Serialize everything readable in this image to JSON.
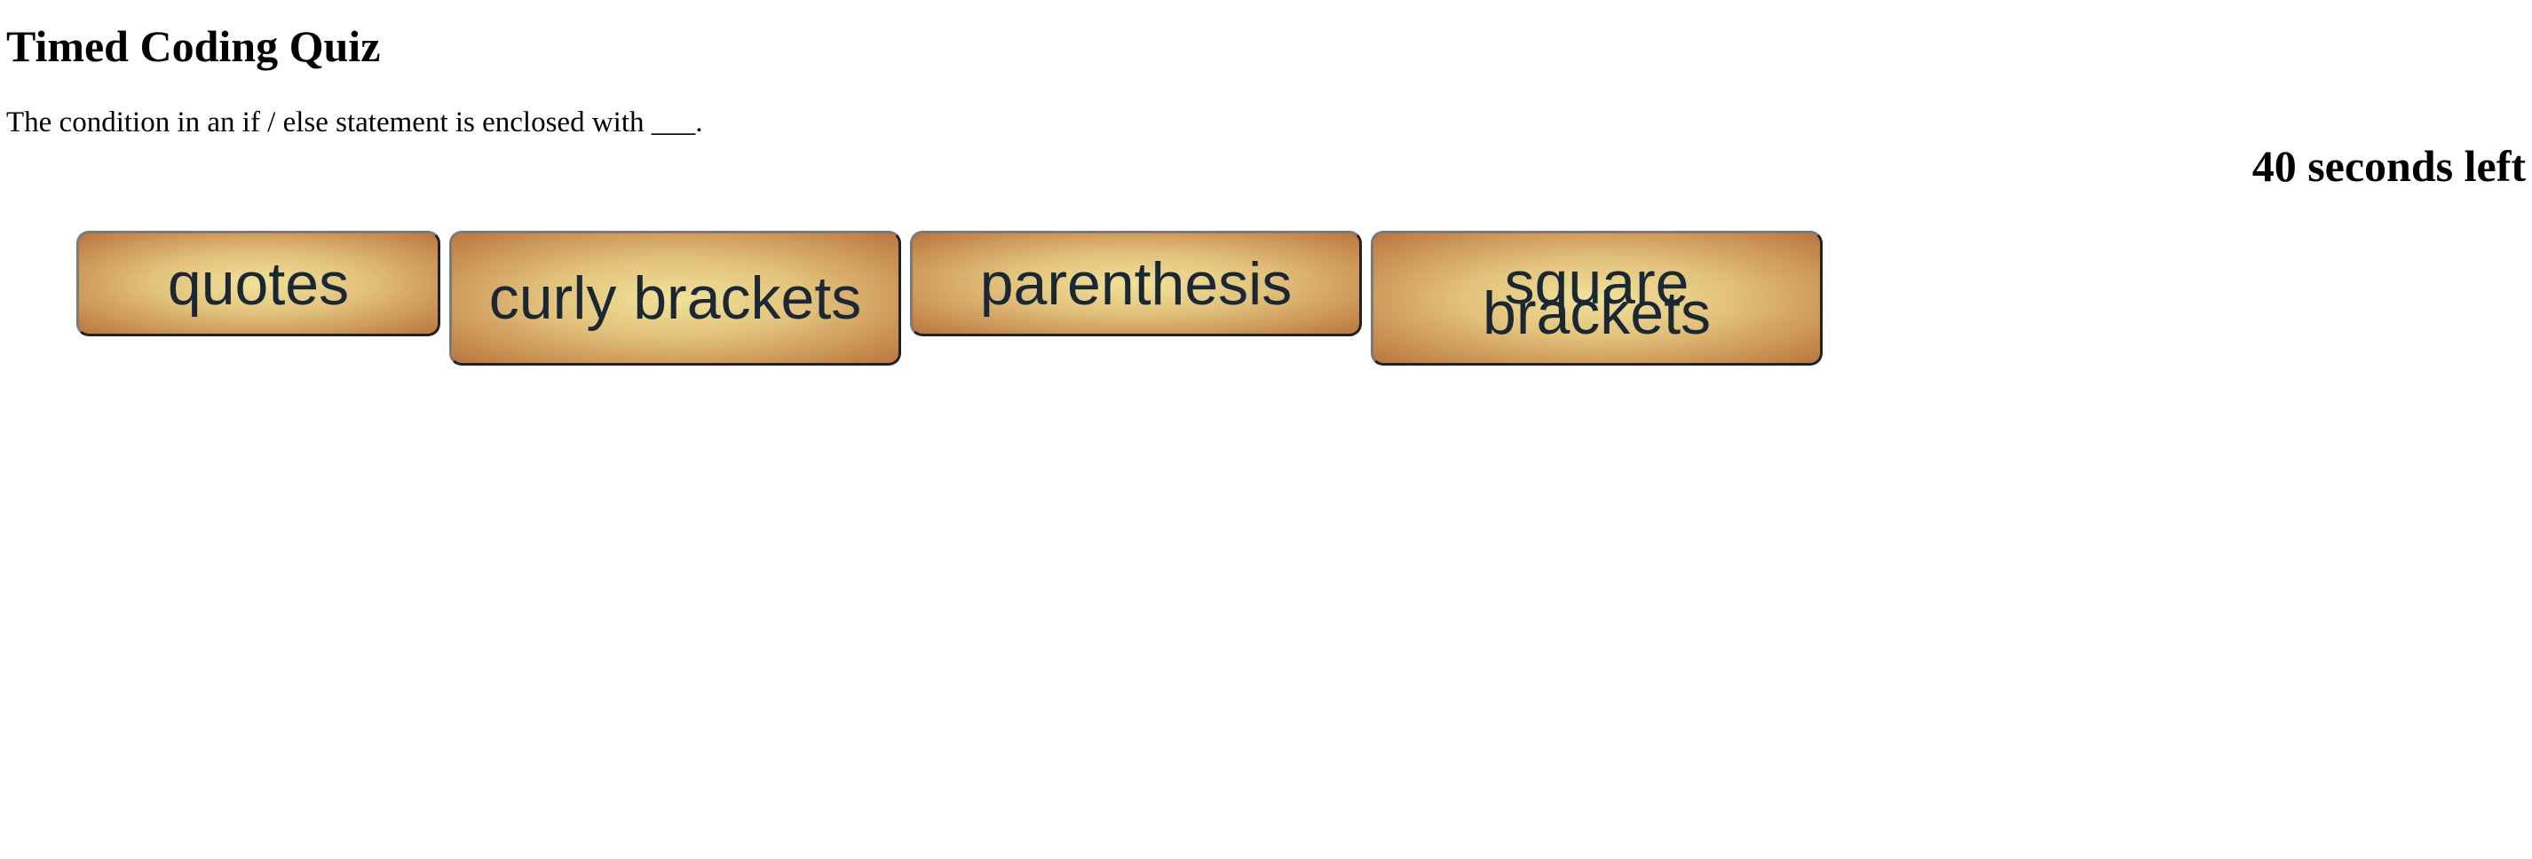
{
  "quiz": {
    "title": "Timed Coding Quiz",
    "question": "The condition in an if / else statement is enclosed with ___.",
    "timer_text": "40 seconds left",
    "answers": [
      {
        "label": "quotes"
      },
      {
        "label": "curly brackets"
      },
      {
        "label": "parenthesis"
      },
      {
        "label": "square brackets"
      }
    ]
  },
  "colors": {
    "button_gradient_center": "#f0e29a",
    "button_gradient_edge": "#bb7540",
    "button_text": "#1b2733"
  }
}
